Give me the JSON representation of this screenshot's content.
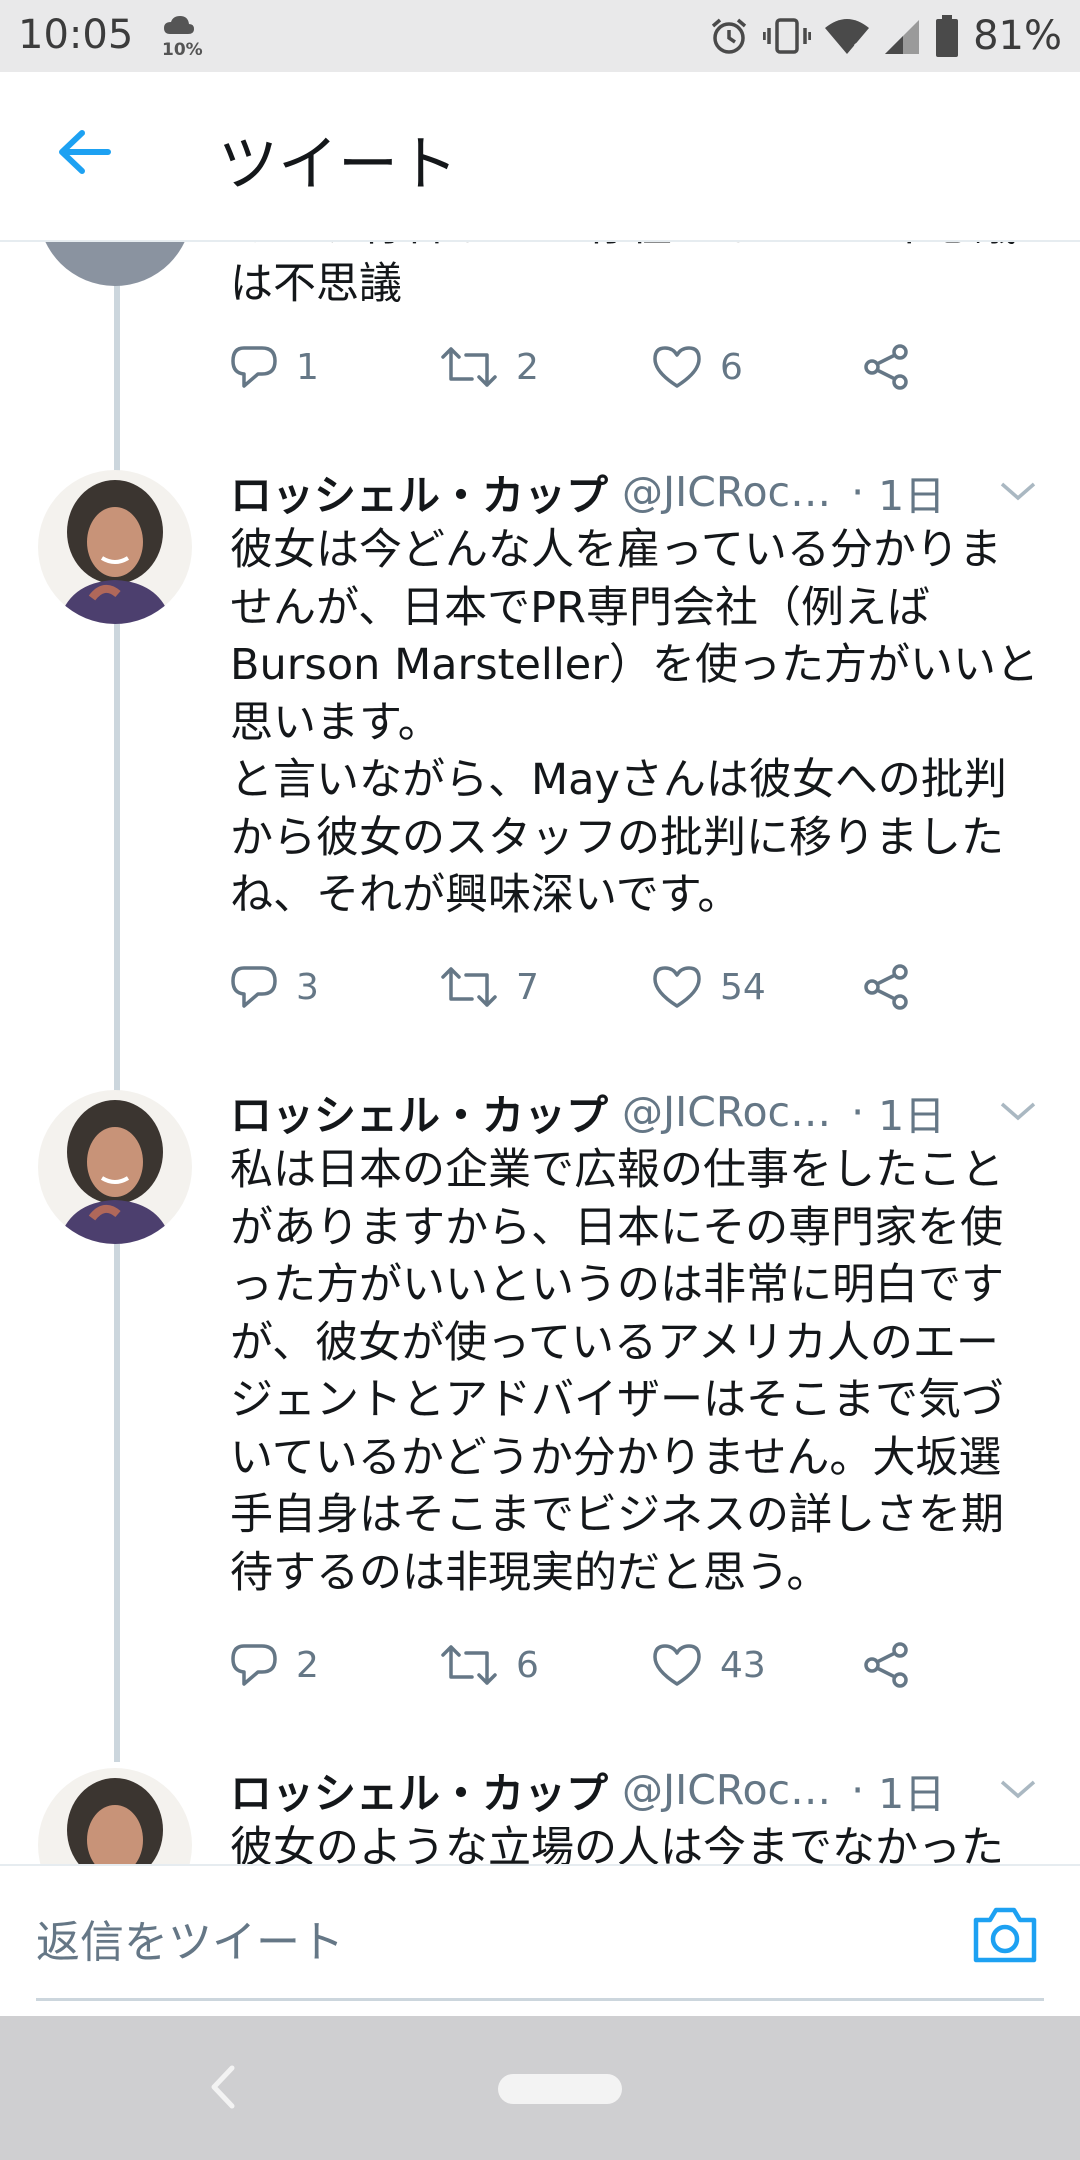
{
  "status_bar": {
    "time": "10:05",
    "weather_pct": "10%",
    "battery_pct": "81%",
    "icons": [
      "cloud-icon",
      "alarm-icon",
      "vibrate-icon",
      "wifi-icon",
      "signal-icon",
      "battery-icon"
    ]
  },
  "header": {
    "title": "ツイート",
    "back_icon": "back-arrow-icon"
  },
  "partial_top_tweet": {
    "text_lines": [
      "あたり有名なPRが存在しないのは不思議",
      "は不思議"
    ],
    "replies": "1",
    "retweets": "2",
    "likes": "6"
  },
  "tweets": [
    {
      "name": "ロッシェル・カップ",
      "handle": "@JICRoc…",
      "time": "1日",
      "text_lines": [
        "彼女は今どんな人を雇っている分かりま",
        "せんが、日本でPR専門会社（例えば",
        "Burson Marsteller）を使った方がいいと",
        "思います。",
        "と言いながら、Mayさんは彼女への批判",
        "から彼女のスタッフの批判に移りました",
        "ね、それが興味深いです。"
      ],
      "replies": "3",
      "retweets": "7",
      "likes": "54"
    },
    {
      "name": "ロッシェル・カップ",
      "handle": "@JICRoc…",
      "time": "1日",
      "text_lines": [
        "私は日本の企業で広報の仕事をしたこと",
        "がありますから、日本にその専門家を使",
        "った方がいいというのは非常に明白です",
        "が、彼女が使っているアメリカ人のエー",
        "ジェントとアドバイザーはそこまで気づ",
        "いているかどうか分かりません。大坂選",
        "手自身はそこまでビジネスの詳しさを期",
        "待するのは非現実的だと思う。"
      ],
      "replies": "2",
      "retweets": "6",
      "likes": "43"
    },
    {
      "name": "ロッシェル・カップ",
      "handle": "@JICRoc…",
      "time": "1日",
      "text_lines": [
        "彼女のような立場の人は今までなかった"
      ]
    }
  ],
  "dot": "·",
  "compose": {
    "placeholder": "返信をツイート",
    "camera_icon": "camera-icon"
  },
  "nav": {
    "back_icon": "nav-back-icon",
    "home_icon": "nav-home-pill"
  },
  "colors": {
    "accent": "#1da1f2",
    "text": "#14171a",
    "muted": "#657786",
    "line": "#ccd6dd"
  }
}
